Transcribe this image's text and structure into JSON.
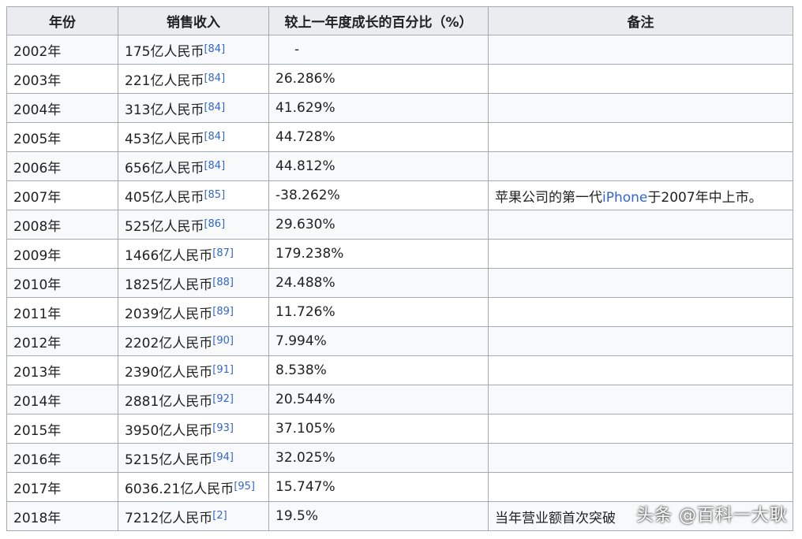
{
  "headers": [
    "年份",
    "销售收入",
    "较上一年度成长的百分比（%）",
    "备注"
  ],
  "rows": [
    {
      "year": "2002年",
      "revenue": "175亿人民币",
      "ref": "[84]",
      "growth": "-",
      "note": "",
      "note_link": "",
      "note_tail": ""
    },
    {
      "year": "2003年",
      "revenue": "221亿人民币",
      "ref": "[84]",
      "growth": "26.286%",
      "note": "",
      "note_link": "",
      "note_tail": ""
    },
    {
      "year": "2004年",
      "revenue": "313亿人民币",
      "ref": "[84]",
      "growth": "41.629%",
      "note": "",
      "note_link": "",
      "note_tail": ""
    },
    {
      "year": "2005年",
      "revenue": "453亿人民币",
      "ref": "[84]",
      "growth": "44.728%",
      "note": "",
      "note_link": "",
      "note_tail": ""
    },
    {
      "year": "2006年",
      "revenue": "656亿人民币",
      "ref": "[84]",
      "growth": "44.812%",
      "note": "",
      "note_link": "",
      "note_tail": ""
    },
    {
      "year": "2007年",
      "revenue": "405亿人民币",
      "ref": "[85]",
      "growth": "-38.262%",
      "note": "苹果公司的第一代",
      "note_link": "iPhone",
      "note_tail": "于2007年中上市。"
    },
    {
      "year": "2008年",
      "revenue": "525亿人民币",
      "ref": "[86]",
      "growth": "29.630%",
      "note": "",
      "note_link": "",
      "note_tail": ""
    },
    {
      "year": "2009年",
      "revenue": "1466亿人民币",
      "ref": "[87]",
      "growth": "179.238%",
      "note": "",
      "note_link": "",
      "note_tail": ""
    },
    {
      "year": "2010年",
      "revenue": "1825亿人民币",
      "ref": "[88]",
      "growth": "24.488%",
      "note": "",
      "note_link": "",
      "note_tail": ""
    },
    {
      "year": "2011年",
      "revenue": "2039亿人民币",
      "ref": "[89]",
      "growth": "11.726%",
      "note": "",
      "note_link": "",
      "note_tail": ""
    },
    {
      "year": "2012年",
      "revenue": "2202亿人民币",
      "ref": "[90]",
      "growth": "7.994%",
      "note": "",
      "note_link": "",
      "note_tail": ""
    },
    {
      "year": "2013年",
      "revenue": "2390亿人民币",
      "ref": "[91]",
      "growth": "8.538%",
      "note": "",
      "note_link": "",
      "note_tail": ""
    },
    {
      "year": "2014年",
      "revenue": "2881亿人民币",
      "ref": "[92]",
      "growth": "20.544%",
      "note": "",
      "note_link": "",
      "note_tail": ""
    },
    {
      "year": "2015年",
      "revenue": "3950亿人民币",
      "ref": "[93]",
      "growth": "37.105%",
      "note": "",
      "note_link": "",
      "note_tail": ""
    },
    {
      "year": "2016年",
      "revenue": "5215亿人民币",
      "ref": "[94]",
      "growth": "32.025%",
      "note": "",
      "note_link": "",
      "note_tail": ""
    },
    {
      "year": "2017年",
      "revenue": "6036.21亿人民币",
      "ref": "[95]",
      "growth": "15.747%",
      "note": "",
      "note_link": "",
      "note_tail": ""
    },
    {
      "year": "2018年",
      "revenue": "7212亿人民币",
      "ref": "[2]",
      "growth": "19.5%",
      "note": "当年营业额首次突破",
      "note_link": "",
      "note_tail": ""
    }
  ],
  "watermark": "头条 @百科一大耿"
}
